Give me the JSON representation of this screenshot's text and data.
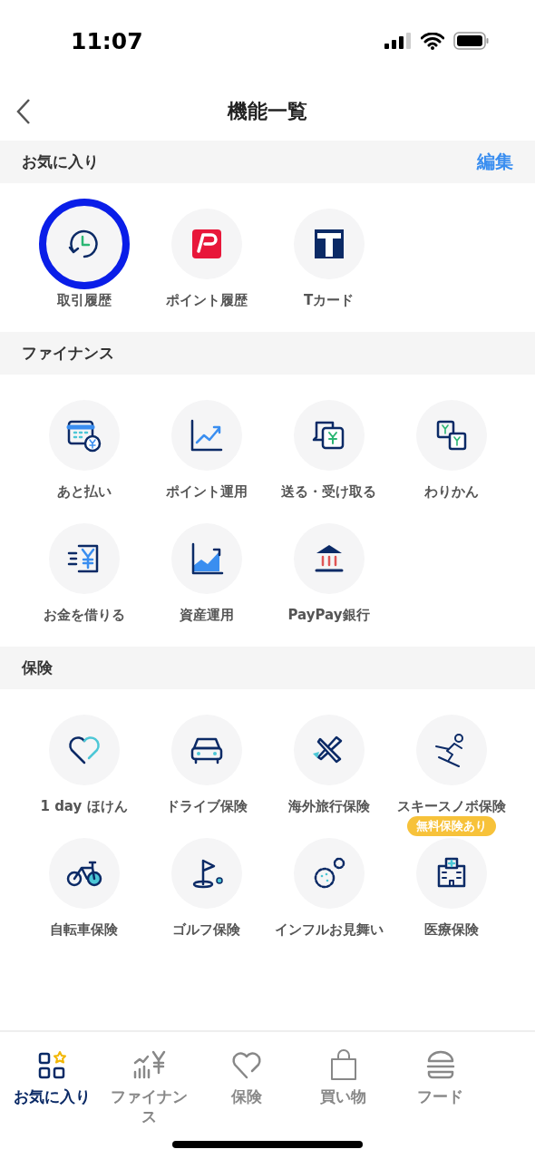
{
  "status_bar": {
    "time": "11:07"
  },
  "header": {
    "title": "機能一覧"
  },
  "sections": [
    {
      "title": "お気に入り",
      "action": "編集",
      "items": [
        {
          "label": "取引履歴",
          "highlighted": true
        },
        {
          "label": "ポイント履歴",
          "highlighted": false
        },
        {
          "label": "Tカード",
          "highlighted": false
        }
      ]
    },
    {
      "title": "ファイナンス",
      "items": [
        {
          "label": "あと払い"
        },
        {
          "label": "ポイント運用"
        },
        {
          "label": "送る・受け取る"
        },
        {
          "label": "わりかん"
        },
        {
          "label": "お金を借りる"
        },
        {
          "label": "資産運用"
        },
        {
          "label": "PayPay銀行"
        }
      ]
    },
    {
      "title": "保険",
      "items": [
        {
          "label": "1 day ほけん"
        },
        {
          "label": "ドライブ保険"
        },
        {
          "label": "海外旅行保険"
        },
        {
          "label": "スキースノボ保険"
        },
        {
          "label": "自転車保険"
        },
        {
          "label": "ゴルフ保険"
        },
        {
          "label": "インフルお見舞い"
        },
        {
          "label": "医療保険",
          "badge": "無料保険あり"
        }
      ]
    }
  ],
  "tab_bar": [
    {
      "label": "お気に入り",
      "selected": true
    },
    {
      "label": "ファイナンス",
      "selected": false
    },
    {
      "label": "保険",
      "selected": false
    },
    {
      "label": "買い物",
      "selected": false
    },
    {
      "label": "フード",
      "selected": false
    }
  ]
}
